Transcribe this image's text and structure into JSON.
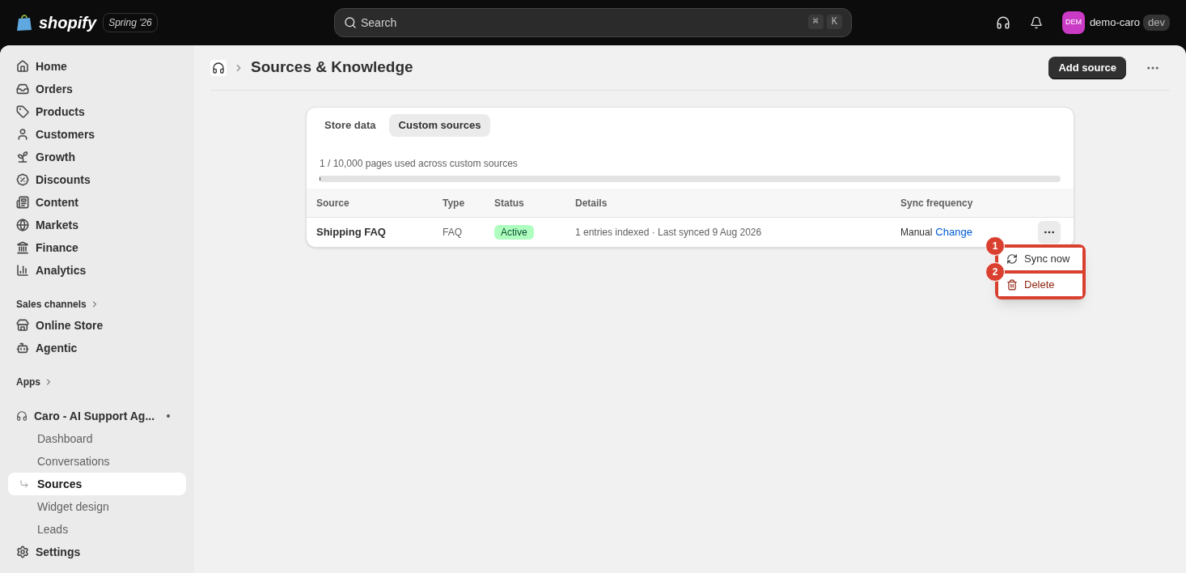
{
  "topbar": {
    "brand": "shopify",
    "edition": "Spring '26",
    "search": {
      "placeholder": "Search",
      "shortcut": [
        "⌘",
        "K"
      ]
    },
    "account": {
      "initials": "DEM",
      "name": "demo-caro",
      "badge": "dev"
    }
  },
  "sidebar": {
    "items": [
      {
        "label": "Home",
        "selected": false
      },
      {
        "label": "Orders",
        "selected": false
      },
      {
        "label": "Products",
        "selected": false
      },
      {
        "label": "Customers",
        "selected": false
      },
      {
        "label": "Growth",
        "selected": false
      },
      {
        "label": "Discounts",
        "selected": false
      },
      {
        "label": "Content",
        "selected": false
      },
      {
        "label": "Markets",
        "selected": false
      },
      {
        "label": "Finance",
        "selected": false
      },
      {
        "label": "Analytics",
        "selected": false
      }
    ],
    "sales_channels": {
      "heading": "Sales channels",
      "items": [
        {
          "label": "Online Store",
          "selected": false
        },
        {
          "label": "Agentic",
          "selected": false
        }
      ]
    },
    "apps": {
      "heading": "Apps",
      "app": {
        "label": "Caro - AI Support Ag...",
        "children": [
          {
            "label": "Dashboard",
            "selected": false
          },
          {
            "label": "Conversations",
            "selected": false
          },
          {
            "label": "Sources",
            "selected": true
          },
          {
            "label": "Widget design",
            "selected": false
          },
          {
            "label": "Leads",
            "selected": false
          }
        ]
      }
    },
    "settings": {
      "label": "Settings"
    }
  },
  "page": {
    "title": "Sources & Knowledge",
    "primary_action": "Add source",
    "tabs": [
      {
        "label": "Store data",
        "selected": false
      },
      {
        "label": "Custom sources",
        "selected": true
      }
    ],
    "usage": {
      "text": "1 / 10,000 pages used across custom sources",
      "level": 0.0001
    },
    "table": {
      "columns": [
        "Source",
        "Type",
        "Status",
        "Details",
        "Sync frequency"
      ],
      "rows": [
        {
          "source": "Shipping FAQ",
          "type": "FAQ",
          "status": "Active",
          "details": "1 entries indexed · Last synced 9 Aug 2026",
          "frequency": "Manual",
          "action": "Change"
        }
      ]
    },
    "menu": [
      {
        "label": "Sync now",
        "kind": "normal",
        "marker": "1",
        "highlighted": true
      },
      {
        "label": "Delete",
        "kind": "destructive",
        "marker": "2",
        "highlighted": true
      }
    ]
  }
}
